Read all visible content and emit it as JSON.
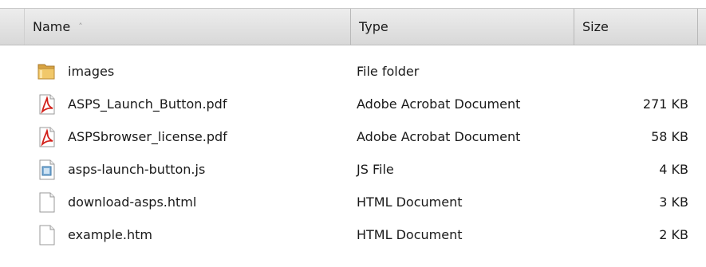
{
  "columns": {
    "name": "Name",
    "sort_indicator": "˄",
    "type": "Type",
    "size": "Size"
  },
  "files": [
    {
      "name": "images",
      "type": "File folder",
      "size": "",
      "icon": "folder-icon"
    },
    {
      "name": "ASPS_Launch_Button.pdf",
      "type": "Adobe Acrobat Document",
      "size": "271 KB",
      "icon": "pdf-icon"
    },
    {
      "name": "ASPSbrowser_license.pdf",
      "type": "Adobe Acrobat Document",
      "size": "58 KB",
      "icon": "pdf-icon"
    },
    {
      "name": "asps-launch-button.js",
      "type": "JS File",
      "size": "4 KB",
      "icon": "script-file-icon"
    },
    {
      "name": "download-asps.html",
      "type": "HTML Document",
      "size": "3 KB",
      "icon": "document-icon"
    },
    {
      "name": "example.htm",
      "type": "HTML Document",
      "size": "2 KB",
      "icon": "document-icon"
    }
  ]
}
